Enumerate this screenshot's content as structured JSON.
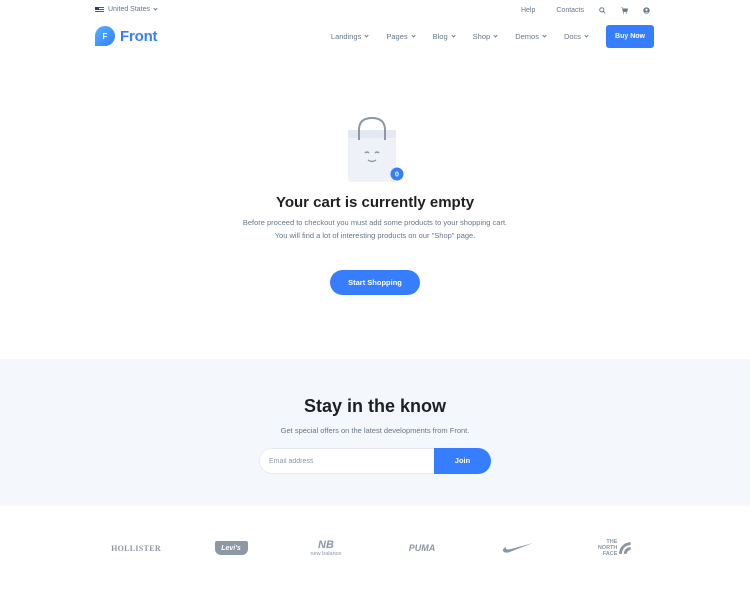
{
  "topbar": {
    "locale": "United States",
    "links": [
      "Help",
      "Contacts"
    ],
    "icons": [
      "search-icon",
      "cart-icon",
      "user-icon"
    ]
  },
  "navbar": {
    "logo_letter": "F",
    "logo_text": "Front",
    "items": [
      {
        "label": "Landings"
      },
      {
        "label": "Pages"
      },
      {
        "label": "Blog"
      },
      {
        "label": "Shop"
      },
      {
        "label": "Demos"
      },
      {
        "label": "Docs"
      }
    ],
    "cta": "Buy Now"
  },
  "cart": {
    "badge_count": "0",
    "title": "Your cart is currently empty",
    "description": "Before proceed to checkout you must add some products to your shopping cart. You will find a lot of interesting products on our \"Shop\" page.",
    "button": "Start Shopping"
  },
  "subscribe": {
    "title": "Stay in the know",
    "description": "Get special offers on the latest developments from Front.",
    "input_placeholder": "Email address",
    "input_value": "",
    "button": "Join"
  },
  "brands": {
    "hollister": "HOLLISTER",
    "levis": "Levi's",
    "new_balance": "new balance",
    "new_balance_mark": "NB",
    "puma": "PUMA",
    "north_face": "THE NORTH FACE"
  },
  "colors": {
    "primary": "#377dff",
    "text_dark": "#1e2022",
    "text_muted": "#677788",
    "section_bg": "#f4f7fc",
    "logo_gray": "#8c98a4"
  }
}
